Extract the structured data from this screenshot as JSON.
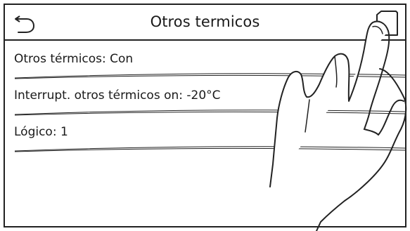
{
  "header": {
    "title": "Otros termicos",
    "back_icon": "back-arrow-icon",
    "home_icon": "home-icon"
  },
  "rows": [
    {
      "label": "Otros térmicos: Con"
    },
    {
      "label": "Interrupt. otros térmicos on: -20°C"
    },
    {
      "label": "Lógico: 1"
    }
  ],
  "colors": {
    "line": "#222222",
    "background": "#ffffff"
  }
}
